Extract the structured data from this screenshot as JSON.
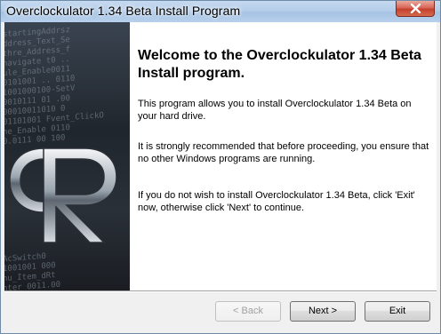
{
  "window": {
    "title": "Overclockulator 1.34 Beta Install Program"
  },
  "side_image": {
    "code_lines": [
      "startingAddrsz",
      "ddress_Text_Se",
      "thre_Address_f",
      "navigate t0 ..",
      "ule_Enable0011",
      "0101001 .. 0110",
      "1001000100-SetV",
      "0010111 01 .00",
      "00010011010 0",
      "01101001 Fvent_ClickO",
      "ne_Enable 0110",
      "0.0111 00 100",
      "",
      "",
      "",
      "",
      "",
      "",
      "",
      "",
      "",
      "",
      "",
      "AcSwitch0",
      "1001001 000",
      "nu_Item_dRt",
      "nter 0011.00"
    ]
  },
  "main": {
    "heading": "Welcome to the Overclockulator 1.34 Beta Install program.",
    "para1": "This program allows you to install Overclockulator 1.34 Beta on your hard drive.",
    "para2": "It is strongly recommended that before proceeding, you ensure that no other Windows programs are running.",
    "para3": "If you do not wish to install Overclockulator 1.34 Beta, click 'Exit' now, otherwise click 'Next' to continue."
  },
  "buttons": {
    "back": "< Back",
    "next": "Next >",
    "exit": "Exit"
  }
}
